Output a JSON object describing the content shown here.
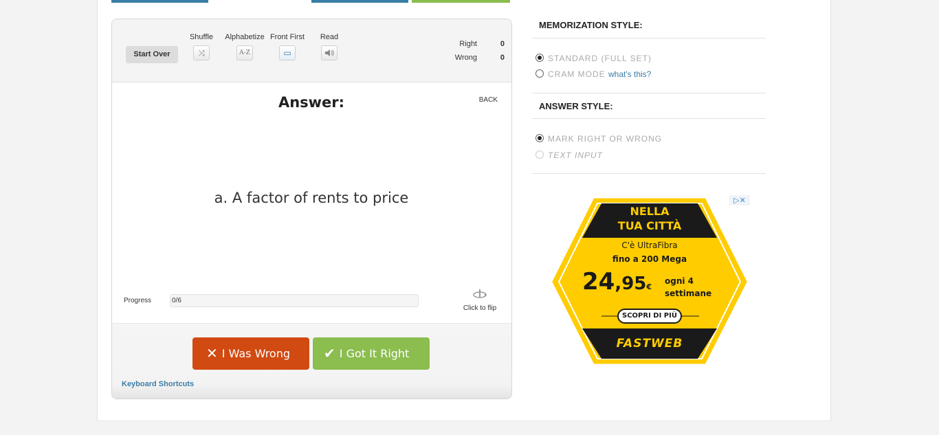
{
  "toolbar": {
    "start_over": "Start Over",
    "tools": [
      {
        "label": "Shuffle",
        "icon": "shuffle-icon",
        "glyph": "⤨"
      },
      {
        "label": "Alphabetize",
        "icon": "alphabetize-icon",
        "glyph": "A-Z"
      },
      {
        "label": "Front First",
        "icon": "front-first-icon",
        "glyph": "▭"
      },
      {
        "label": "Read",
        "icon": "speaker-icon",
        "glyph": "🔈"
      }
    ],
    "score": {
      "right_label": "Right",
      "right_value": "0",
      "wrong_label": "Wrong",
      "wrong_value": "0"
    }
  },
  "card": {
    "title": "Answer:",
    "back_link": "BACK",
    "text": "a. A factor of rents to price",
    "progress_label": "Progress",
    "progress_text": "0/6",
    "progress_fraction": 0,
    "flip_label": "Click to flip"
  },
  "actions": {
    "wrong_label": "I Was Wrong",
    "right_label": "I Got It Right",
    "keyboard_shortcuts": "Keyboard Shortcuts"
  },
  "settings": {
    "memorization_title": "MEMORIZATION STYLE:",
    "memorization_options": [
      {
        "label": "STANDARD (FULL SET)",
        "selected": true
      },
      {
        "label": "CRAM MODE",
        "selected": false,
        "help": "what's this?"
      }
    ],
    "answer_title": "ANSWER STYLE:",
    "answer_options": [
      {
        "label": "MARK RIGHT OR WRONG",
        "selected": true
      },
      {
        "label": "TEXT INPUT",
        "selected": false
      }
    ]
  },
  "ad": {
    "line1": "NELLA",
    "line2": "TUA CITTÀ",
    "line3": "C'è UltraFibra",
    "line4": "fino a 200 Mega",
    "price_int": "24",
    "price_dec": ",95",
    "currency": "€",
    "period1": "ogni 4",
    "period2": "settimane",
    "cta": "SCOPRI DI PIÙ",
    "brand": "FASTWEB",
    "colors": {
      "yellow": "#ffcc00",
      "black": "#1a1a1a"
    }
  },
  "colors": {
    "accent_blue": "#3a7ea5",
    "wrong_orange": "#d14a12",
    "right_green": "#8bbd4f"
  }
}
